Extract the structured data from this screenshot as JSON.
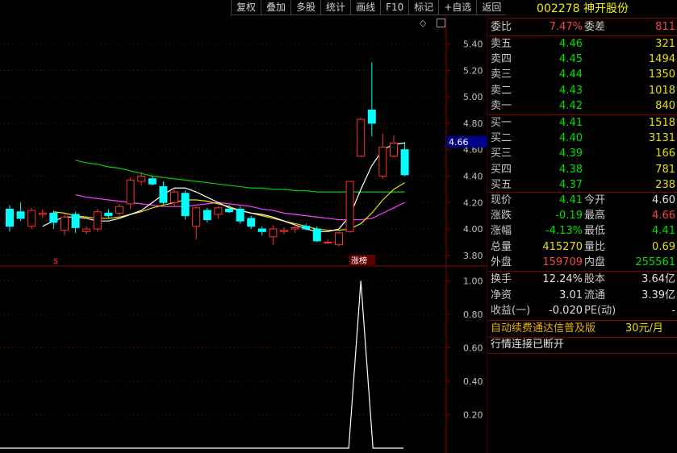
{
  "toolbar": [
    "复权",
    "叠加",
    "多股",
    "统计",
    "画线",
    "F10",
    "标记",
    "+自选",
    "返回"
  ],
  "chart": {
    "price_ticks": [
      "5.40",
      "5.20",
      "5.00",
      "4.80",
      "4.60",
      "4.40",
      "4.20",
      "4.00",
      "3.80"
    ],
    "current_price_tag": "4.66",
    "markers": {
      "s": "$",
      "zhangbang": "涨榜"
    },
    "indicator_ticks": [
      "1.00",
      "0.80",
      "0.60",
      "0.40",
      "0.20"
    ],
    "colors": {
      "up": "#ff3030",
      "down": "#00ffff",
      "ma1": "#ffffff",
      "ma2": "#e8e000",
      "ma3": "#ff40ff",
      "ma4": "#00d000",
      "grid": "#8b0000"
    }
  },
  "chart_data": {
    "type": "candlestick",
    "ylim": [
      3.75,
      5.55
    ],
    "candles": [
      {
        "o": 4.15,
        "h": 4.18,
        "l": 3.98,
        "c": 4.02
      },
      {
        "o": 4.13,
        "h": 4.2,
        "l": 4.06,
        "c": 4.08
      },
      {
        "o": 4.02,
        "h": 4.16,
        "l": 4.0,
        "c": 4.14
      },
      {
        "o": 4.11,
        "h": 4.15,
        "l": 4.08,
        "c": 4.12
      },
      {
        "o": 4.12,
        "h": 4.14,
        "l": 4.0,
        "c": 4.05
      },
      {
        "o": 3.99,
        "h": 4.12,
        "l": 3.95,
        "c": 4.09
      },
      {
        "o": 4.11,
        "h": 4.13,
        "l": 3.97,
        "c": 4.01
      },
      {
        "o": 3.98,
        "h": 4.02,
        "l": 3.96,
        "c": 4.0
      },
      {
        "o": 4.0,
        "h": 4.15,
        "l": 3.98,
        "c": 4.13
      },
      {
        "o": 4.12,
        "h": 4.15,
        "l": 4.08,
        "c": 4.1
      },
      {
        "o": 4.12,
        "h": 4.19,
        "l": 4.1,
        "c": 4.17
      },
      {
        "o": 4.19,
        "h": 4.39,
        "l": 4.15,
        "c": 4.37
      },
      {
        "o": 4.36,
        "h": 4.43,
        "l": 4.33,
        "c": 4.4
      },
      {
        "o": 4.38,
        "h": 4.4,
        "l": 4.33,
        "c": 4.34
      },
      {
        "o": 4.32,
        "h": 4.36,
        "l": 4.18,
        "c": 4.2
      },
      {
        "o": 4.2,
        "h": 4.3,
        "l": 4.17,
        "c": 4.28
      },
      {
        "o": 4.27,
        "h": 4.29,
        "l": 4.07,
        "c": 4.1
      },
      {
        "o": 4.02,
        "h": 4.17,
        "l": 3.92,
        "c": 4.16
      },
      {
        "o": 4.14,
        "h": 4.16,
        "l": 4.05,
        "c": 4.07
      },
      {
        "o": 4.11,
        "h": 4.17,
        "l": 4.08,
        "c": 4.16
      },
      {
        "o": 4.15,
        "h": 4.18,
        "l": 4.12,
        "c": 4.13
      },
      {
        "o": 4.15,
        "h": 4.17,
        "l": 4.04,
        "c": 4.06
      },
      {
        "o": 4.08,
        "h": 4.1,
        "l": 4.0,
        "c": 4.02
      },
      {
        "o": 4.0,
        "h": 4.02,
        "l": 3.95,
        "c": 3.98
      },
      {
        "o": 3.94,
        "h": 4.03,
        "l": 3.88,
        "c": 4.0
      },
      {
        "o": 3.98,
        "h": 4.01,
        "l": 3.96,
        "c": 3.99
      },
      {
        "o": 4.0,
        "h": 4.03,
        "l": 3.97,
        "c": 4.01
      },
      {
        "o": 4.02,
        "h": 4.04,
        "l": 3.99,
        "c": 4.0
      },
      {
        "o": 4.0,
        "h": 4.02,
        "l": 3.9,
        "c": 3.91
      },
      {
        "o": 3.9,
        "h": 3.92,
        "l": 3.89,
        "c": 3.9
      },
      {
        "o": 3.88,
        "h": 3.98,
        "l": 3.87,
        "c": 3.97
      },
      {
        "o": 3.98,
        "h": 4.36,
        "l": 3.97,
        "c": 4.36
      },
      {
        "o": 4.55,
        "h": 4.84,
        "l": 4.55,
        "c": 4.83
      },
      {
        "o": 4.9,
        "h": 5.26,
        "l": 4.7,
        "c": 4.8
      },
      {
        "o": 4.4,
        "h": 4.72,
        "l": 4.38,
        "c": 4.62
      },
      {
        "o": 4.55,
        "h": 4.71,
        "l": 4.54,
        "c": 4.65
      },
      {
        "o": 4.6,
        "h": 4.66,
        "l": 4.4,
        "c": 4.41
      }
    ],
    "ma_white": [
      4.02,
      4.06,
      4.09,
      4.09,
      4.08,
      4.06,
      4.06,
      4.08,
      4.11,
      4.14,
      4.2,
      4.26,
      4.31,
      4.31,
      4.28,
      4.24,
      4.2,
      4.16,
      4.14,
      4.12,
      4.11,
      4.09,
      4.06,
      4.03,
      4.0,
      3.98,
      3.98,
      4.0,
      4.1,
      4.3,
      4.48,
      4.6,
      4.64,
      4.65
    ],
    "ma_yellow": [
      4.13,
      4.12,
      4.1,
      4.09,
      4.08,
      4.08,
      4.09,
      4.11,
      4.13,
      4.16,
      4.18,
      4.2,
      4.22,
      4.22,
      4.21,
      4.19,
      4.17,
      4.14,
      4.12,
      4.1,
      4.08,
      4.06,
      4.04,
      4.02,
      4.0,
      3.99,
      3.99,
      4.0,
      4.04,
      4.12,
      4.22,
      4.3,
      4.35
    ],
    "ma_magenta": [
      4.26,
      4.24,
      4.23,
      4.22,
      4.21,
      4.2,
      4.19,
      4.18,
      4.17,
      4.17,
      4.17,
      4.18,
      4.19,
      4.2,
      4.19,
      4.18,
      4.17,
      4.15,
      4.14,
      4.12,
      4.11,
      4.1,
      4.09,
      4.08,
      4.07,
      4.07,
      4.07,
      4.08,
      4.12,
      4.16,
      4.2
    ],
    "ma_green": [
      4.52,
      4.5,
      4.49,
      4.47,
      4.46,
      4.44,
      4.42,
      4.4,
      4.39,
      4.38,
      4.37,
      4.36,
      4.35,
      4.34,
      4.33,
      4.32,
      4.31,
      4.31,
      4.3,
      4.3,
      4.29,
      4.29,
      4.28,
      4.28,
      4.28,
      4.28,
      4.28,
      4.28,
      4.28,
      4.28,
      4.28
    ],
    "indicator": {
      "ylim": [
        0,
        1.05
      ],
      "spike_index": 32,
      "values_flat": 0,
      "spike_value": 1.0
    }
  },
  "panel": {
    "code": "002278",
    "name": "神开股份",
    "weibi_label": "委比",
    "weibi": "7.47%",
    "weicha_label": "委差",
    "weicha": "811",
    "asks": [
      {
        "label": "卖五",
        "price": "4.46",
        "vol": "321"
      },
      {
        "label": "卖四",
        "price": "4.45",
        "vol": "1494"
      },
      {
        "label": "卖三",
        "price": "4.44",
        "vol": "1350"
      },
      {
        "label": "卖二",
        "price": "4.43",
        "vol": "1018"
      },
      {
        "label": "卖一",
        "price": "4.42",
        "vol": "840"
      }
    ],
    "bids": [
      {
        "label": "买一",
        "price": "4.41",
        "vol": "1518"
      },
      {
        "label": "买二",
        "price": "4.40",
        "vol": "3131"
      },
      {
        "label": "买三",
        "price": "4.39",
        "vol": "166"
      },
      {
        "label": "买四",
        "price": "4.38",
        "vol": "781"
      },
      {
        "label": "买五",
        "price": "4.37",
        "vol": "238"
      }
    ],
    "stats": [
      {
        "l1": "现价",
        "v1": "4.41",
        "c1": "g",
        "l2": "今开",
        "v2": "4.60",
        "c2": "w"
      },
      {
        "l1": "涨跌",
        "v1": "-0.19",
        "c1": "g",
        "l2": "最高",
        "v2": "4.66",
        "c2": "r"
      },
      {
        "l1": "涨幅",
        "v1": "-4.13%",
        "c1": "g",
        "l2": "最低",
        "v2": "4.41",
        "c2": "g"
      },
      {
        "l1": "总量",
        "v1": "415270",
        "c1": "y",
        "l2": "量比",
        "v2": "0.69",
        "c2": "y"
      },
      {
        "l1": "外盘",
        "v1": "159709",
        "c1": "r",
        "l2": "内盘",
        "v2": "255561",
        "c2": "g"
      }
    ],
    "fund": [
      {
        "l1": "换手",
        "v1": "12.24%",
        "l2": "股本",
        "v2": "3.64亿"
      },
      {
        "l1": "净资",
        "v1": "3.01",
        "l2": "流通",
        "v2": "3.39亿"
      },
      {
        "l1": "收益(一)",
        "v1": "-0.020",
        "l2": "PE(动)",
        "v2": "-"
      }
    ],
    "promo": "自动续费通达信普及版",
    "promo_price": "30元/月",
    "status": "行情连接已断开"
  }
}
